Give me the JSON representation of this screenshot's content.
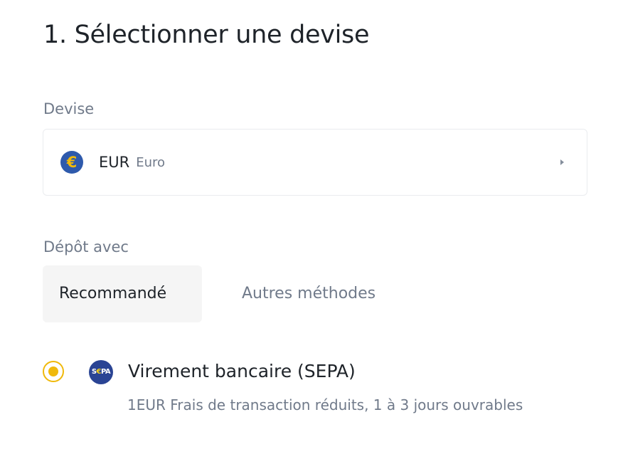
{
  "page_title": "1. Sélectionner une devise",
  "currency": {
    "label": "Devise",
    "selected_code": "EUR",
    "selected_name": "Euro",
    "icon_glyph": "€",
    "icon_name": "euro-icon",
    "dropdown_icon": "caret-right-icon"
  },
  "deposit": {
    "label": "Dépôt avec",
    "tabs": [
      {
        "label": "Recommandé",
        "active": true
      },
      {
        "label": "Autres méthodes",
        "active": false
      }
    ]
  },
  "methods": [
    {
      "title": "Virement bancaire (SEPA)",
      "description": "1EUR Frais de transaction réduits, 1 à 3 jours ouvrables",
      "selected": true,
      "logo_name": "sepa-logo"
    }
  ],
  "colors": {
    "accent": "#f0b90b",
    "text_primary": "#1e2329",
    "text_secondary": "#707a8a",
    "border": "#eaecef",
    "tab_active_bg": "#f5f5f5",
    "euro_icon_bg": "#2e5aac",
    "sepa_logo_bg": "#2a4494"
  }
}
